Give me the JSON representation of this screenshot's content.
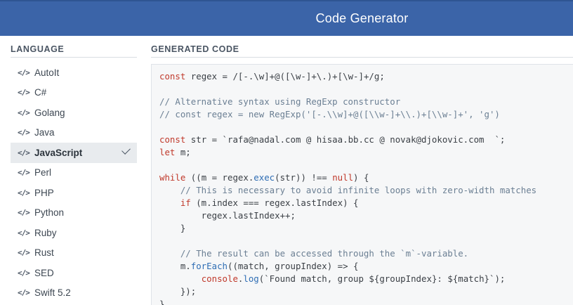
{
  "header": {
    "title": "Code Generator"
  },
  "sidebar": {
    "heading": "LANGUAGE",
    "items": [
      {
        "icon": "</>",
        "label": "AutoIt",
        "selected": false
      },
      {
        "icon": "</>",
        "label": "C#",
        "selected": false
      },
      {
        "icon": "</>",
        "label": "Golang",
        "selected": false
      },
      {
        "icon": "</>",
        "label": "Java",
        "selected": false
      },
      {
        "icon": "</>",
        "label": "JavaScript",
        "selected": true
      },
      {
        "icon": "</>",
        "label": "Perl",
        "selected": false
      },
      {
        "icon": "</>",
        "label": "PHP",
        "selected": false
      },
      {
        "icon": "</>",
        "label": "Python",
        "selected": false
      },
      {
        "icon": "</>",
        "label": "Ruby",
        "selected": false
      },
      {
        "icon": "</>",
        "label": "Rust",
        "selected": false
      },
      {
        "icon": "</>",
        "label": "SED",
        "selected": false
      },
      {
        "icon": "</>",
        "label": "Swift 5.2",
        "selected": false
      }
    ]
  },
  "main": {
    "heading": "GENERATED CODE",
    "code_lines": [
      [
        [
          "kw",
          "const"
        ],
        [
          "pn",
          " regex = /[-.\\w]+@([\\w-]+\\.)+[\\w-]+/g;"
        ]
      ],
      [],
      [
        [
          "cm",
          "// Alternative syntax using RegExp constructor"
        ]
      ],
      [
        [
          "cm",
          "// const regex = new RegExp('[-.\\\\w]+@([\\\\w-]+\\\\.)+[\\\\w-]+', 'g')"
        ]
      ],
      [],
      [
        [
          "kw",
          "const"
        ],
        [
          "pn",
          " str = `rafa@nadal.com @ hisaa.bb.cc @ novak@djokovic.com  `;"
        ]
      ],
      [
        [
          "kw",
          "let"
        ],
        [
          "pn",
          " m;"
        ]
      ],
      [],
      [
        [
          "kw",
          "while"
        ],
        [
          "pn",
          " ((m = regex."
        ],
        [
          "fn",
          "exec"
        ],
        [
          "pn",
          "(str)) !== "
        ],
        [
          "kw",
          "null"
        ],
        [
          "pn",
          ") {"
        ]
      ],
      [
        [
          "pn",
          "    "
        ],
        [
          "cm",
          "// This is necessary to avoid infinite loops with zero-width matches"
        ]
      ],
      [
        [
          "pn",
          "    "
        ],
        [
          "kw",
          "if"
        ],
        [
          "pn",
          " (m.index === regex.lastIndex) {"
        ]
      ],
      [
        [
          "pn",
          "        regex.lastIndex++;"
        ]
      ],
      [
        [
          "pn",
          "    }"
        ]
      ],
      [],
      [
        [
          "pn",
          "    "
        ],
        [
          "cm",
          "// The result can be accessed through the `m`-variable."
        ]
      ],
      [
        [
          "pn",
          "    m."
        ],
        [
          "fn",
          "forEach"
        ],
        [
          "pn",
          "((match, groupIndex) => {"
        ]
      ],
      [
        [
          "pn",
          "        "
        ],
        [
          "kw",
          "console"
        ],
        [
          "pn",
          "."
        ],
        [
          "fn",
          "log"
        ],
        [
          "pn",
          "(`Found match, group ${groupIndex}: ${match}`);"
        ]
      ],
      [
        [
          "pn",
          "    });"
        ]
      ],
      [
        [
          "pn",
          "}"
        ]
      ]
    ]
  }
}
